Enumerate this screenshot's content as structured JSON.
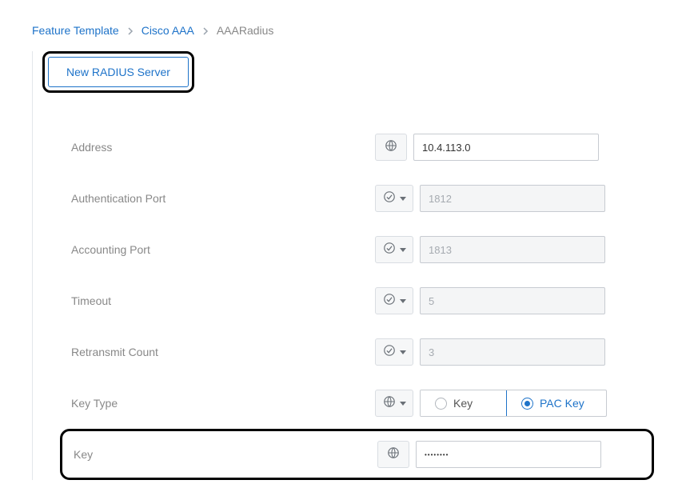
{
  "breadcrumb": {
    "item1": "Feature Template",
    "item2": "Cisco AAA",
    "item3": "AAARadius"
  },
  "buttons": {
    "new_radius": "New RADIUS Server"
  },
  "labels": {
    "address": "Address",
    "auth_port": "Authentication Port",
    "acct_port": "Accounting Port",
    "timeout": "Timeout",
    "retransmit": "Retransmit Count",
    "key_type": "Key Type",
    "key": "Key"
  },
  "values": {
    "address": "10.4.113.0",
    "auth_port_ph": "1812",
    "acct_port_ph": "1813",
    "timeout_ph": "5",
    "retransmit_ph": "3",
    "key_value": "••••••••"
  },
  "key_type_options": {
    "key": "Key",
    "pac_key": "PAC Key"
  }
}
